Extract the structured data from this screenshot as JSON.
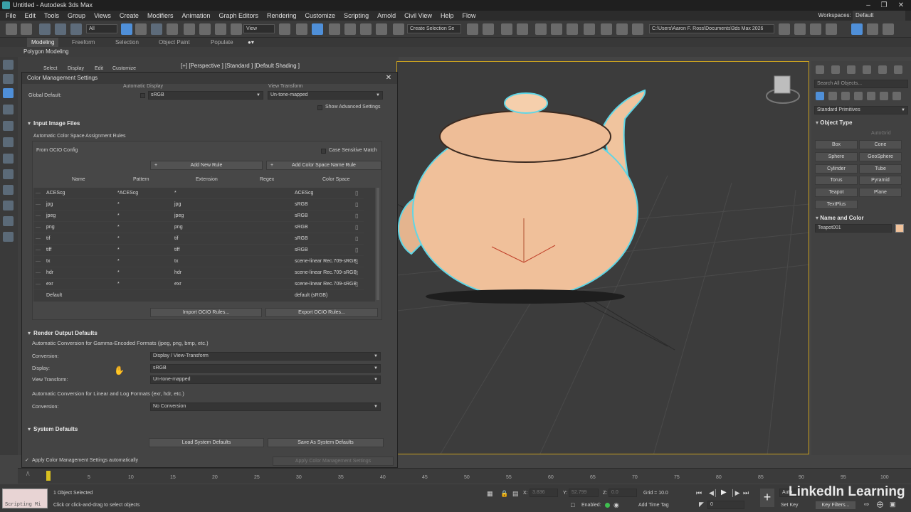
{
  "window": {
    "title": "Untitled - Autodesk 3ds Max",
    "controls": [
      "minimize",
      "maximize",
      "close"
    ]
  },
  "menu": {
    "items": [
      "File",
      "Edit",
      "Tools",
      "Group",
      "Views",
      "Create",
      "Modifiers",
      "Animation",
      "Graph Editors",
      "Rendering",
      "Customize",
      "Scripting",
      "Arnold",
      "Civil View",
      "Help",
      "Flow"
    ],
    "workspaces_label": "Workspaces:",
    "workspaces_value": "Default"
  },
  "toolbar": {
    "filter_value": "All",
    "view_value": "View",
    "selection_set": "Create Selection Se",
    "project_path": "C:\\Users\\Aaron F. Ross\\Documents\\3ds Max 2026"
  },
  "ribbon": {
    "tabs": [
      "Modeling",
      "Freeform",
      "Selection",
      "Object Paint",
      "Populate"
    ],
    "sub_label": "Polygon Modeling"
  },
  "explorer": {
    "menu": [
      "Select",
      "Display",
      "Edit",
      "Customize"
    ]
  },
  "viewport": {
    "label": "[+] [Perspective ] [Standard ] [Default Shading ]"
  },
  "dialog": {
    "title": "Color Management Settings",
    "header_display": "Automatic  Display",
    "header_view": "View Transform",
    "global_default_label": "Global Default:",
    "global_display": "sRGB",
    "global_view": "Un-tone-mapped",
    "show_advanced": "Show Advanced Settings",
    "input_section": "Input Image Files",
    "auto_rules_label": "Automatic Color Space Assignment Rules",
    "from_ocio": "From OCIO Config",
    "case_sensitive": "Case Sensitive Match",
    "add_new_rule": "Add New Rule",
    "add_cs_name_rule": "Add Color Space Name Rule",
    "columns": [
      "Name",
      "Pattern",
      "Extension",
      "Regex",
      "Color Space"
    ],
    "rules": [
      {
        "name": "ACEScg",
        "pattern": "*ACEScg",
        "ext": "*",
        "cs": "ACEScg"
      },
      {
        "name": "jpg",
        "pattern": "*",
        "ext": "jpg",
        "cs": "sRGB"
      },
      {
        "name": "jpeg",
        "pattern": "*",
        "ext": "jpeg",
        "cs": "sRGB"
      },
      {
        "name": "png",
        "pattern": "*",
        "ext": "png",
        "cs": "sRGB"
      },
      {
        "name": "tif",
        "pattern": "*",
        "ext": "tif",
        "cs": "sRGB"
      },
      {
        "name": "tiff",
        "pattern": "*",
        "ext": "tiff",
        "cs": "sRGB"
      },
      {
        "name": "tx",
        "pattern": "*",
        "ext": "tx",
        "cs": "scene-linear Rec.709-sRGB"
      },
      {
        "name": "hdr",
        "pattern": "*",
        "ext": "hdr",
        "cs": "scene-linear Rec.709-sRGB"
      },
      {
        "name": "exr",
        "pattern": "*",
        "ext": "exr",
        "cs": "scene-linear Rec.709-sRGB"
      },
      {
        "name": "Default",
        "pattern": "",
        "ext": "",
        "cs": "default (sRGB)"
      }
    ],
    "import_ocio": "Import OCIO Rules...",
    "export_ocio": "Export OCIO Rules...",
    "render_section": "Render Output Defaults",
    "gamma_label": "Automatic Conversion for Gamma-Encoded Formats (jpeg, png, bmp, etc.)",
    "conversion_label": "Conversion:",
    "conversion_value": "Display / View-Transform",
    "display_label": "Display:",
    "display_value": "sRGB",
    "view_transform_label": "View Transform:",
    "view_transform_value": "Un-tone-mapped",
    "linear_label": "Automatic Conversion for Linear and Log Formats (exr, hdr, etc.)",
    "conversion2_label": "Conversion:",
    "conversion2_value": "No Conversion",
    "system_section": "System Defaults",
    "load_defaults": "Load System Defaults",
    "save_defaults": "Save As System Defaults",
    "apply_auto": "Apply Color Management Settings automatically",
    "apply_button": "Apply Color Management Settings"
  },
  "command_panel": {
    "search_placeholder": "Search All Objects...",
    "category": "Standard Primitives",
    "object_type": "Object Type",
    "autogrid": "AutoGrid",
    "buttons": [
      "Box",
      "Cone",
      "Sphere",
      "GeoSphere",
      "Cylinder",
      "Tube",
      "Torus",
      "Pyramid",
      "Teapot",
      "Plane",
      "TextPlus"
    ],
    "name_color": "Name and Color",
    "object_name": "Teapot001",
    "swatch_color": "#f1c29a"
  },
  "timeline": {
    "ticks": [
      "5",
      "10",
      "15",
      "20",
      "25",
      "30",
      "35",
      "40",
      "45",
      "50",
      "55",
      "60",
      "65",
      "70",
      "75",
      "80",
      "85",
      "90",
      "95",
      "100"
    ],
    "left_marker": "0"
  },
  "status": {
    "script_label": "Scripting Mi",
    "selected": "1 Object Selected",
    "prompt": "Click or click-and-drag to select objects",
    "x_label": "X:",
    "x_value": "3.836",
    "y_label": "Y:",
    "y_value": "52.799",
    "z_label": "Z:",
    "z_value": "0.0",
    "grid": "Grid = 10.0",
    "enabled": "Enabled:",
    "add_time_tag": "Add Time Tag",
    "set_key": "Set Key",
    "key_filters": "Key Filters...",
    "frame": "0",
    "auto_key": "Auto"
  },
  "watermark": "LinkedIn Learning",
  "colors": {
    "teapot": "#f0c09a",
    "selection_outline": "#5fd6e6",
    "viewport_border": "#c8a020"
  }
}
